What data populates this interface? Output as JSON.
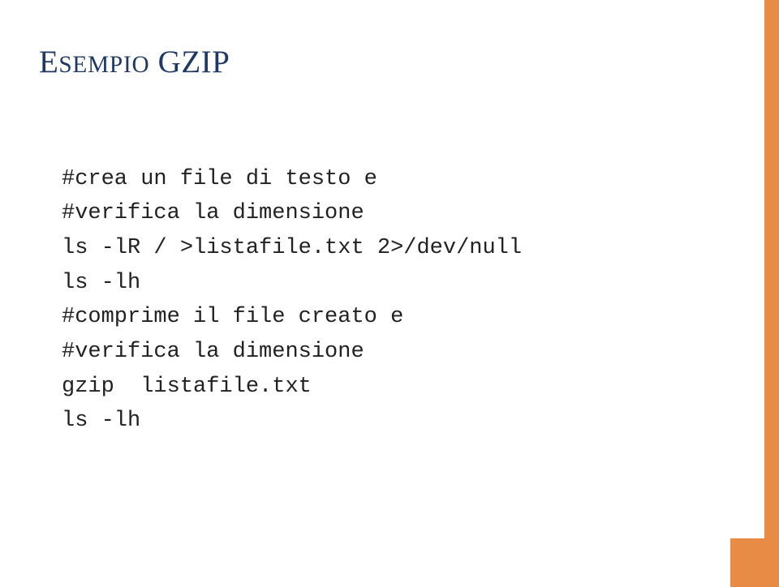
{
  "slide": {
    "title_caps": "E",
    "title_rest_small": "SEMPIO",
    "title_space": " ",
    "title_caps2": "GZIP",
    "code_lines": [
      "#crea un file di testo e",
      "#verifica la dimensione",
      "ls -lR / >listafile.txt 2>/dev/null",
      "ls -lh",
      "#comprime il file creato e",
      "#verifica la dimensione",
      "gzip  listafile.txt",
      "ls -lh"
    ]
  },
  "colors": {
    "accent": "#e88b45",
    "title": "#1f3864"
  }
}
